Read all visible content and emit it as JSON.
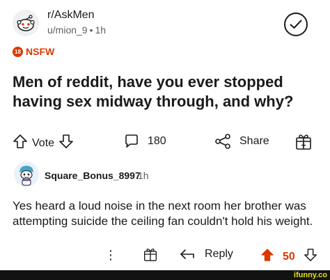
{
  "post": {
    "subreddit": "r/AskMen",
    "author": "u/mion_9",
    "separator": "•",
    "age": "1h",
    "nsfw_badge": "18",
    "nsfw_label": "NSFW",
    "title": "Men of reddit, have you ever stopped\nhaving sex midway through, and why?",
    "actions": {
      "vote_label": "Vote",
      "comment_count": "180",
      "share_label": "Share"
    }
  },
  "comment": {
    "username": "Square_Bonus_8997",
    "age": "1h",
    "body": "Yes heard a loud noise in the next room her brother was attempting suicide the ceiling fan couldn't hold his weight.",
    "actions": {
      "more_label": "⋮",
      "reply_label": "Reply",
      "score": "50"
    }
  },
  "watermark": "ifunny.co",
  "colors": {
    "accent": "#d93a00",
    "text": "#1a1a1b",
    "muted": "#5b5f63",
    "watermark": "#e8e600"
  }
}
